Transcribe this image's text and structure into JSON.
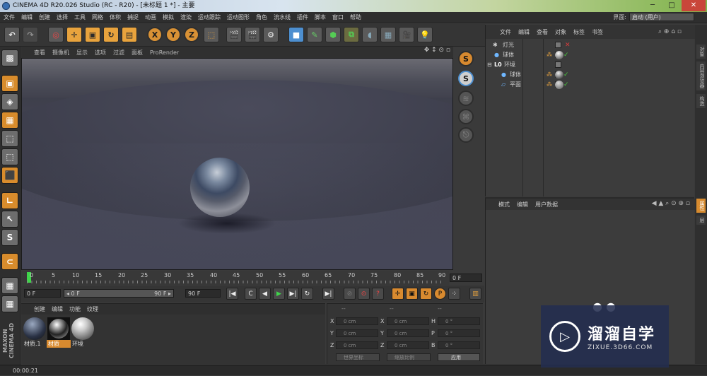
{
  "window": {
    "title": "CINEMA 4D R20.026 Studio (RC - R20) - [未标题 1 *] - 主要",
    "minimize": "─",
    "maximize": "□",
    "close": "✕"
  },
  "menu": [
    "文件",
    "编辑",
    "创建",
    "选择",
    "工具",
    "网格",
    "体积",
    "捕捉",
    "动画",
    "模拟",
    "渲染",
    "运动跟踪",
    "运动图形",
    "角色",
    "流水线",
    "插件",
    "脚本",
    "窗口",
    "帮助"
  ],
  "layout": {
    "label": "界面:",
    "value": "启动 (用户)"
  },
  "viewport": {
    "menu": [
      "查看",
      "摄像机",
      "显示",
      "选项",
      "过滤",
      "面板",
      "ProRender"
    ]
  },
  "objects": {
    "menu": [
      "文件",
      "编辑",
      "查看",
      "对象",
      "标签",
      "书签"
    ],
    "rows": [
      {
        "name": "灯光"
      },
      {
        "name": "球体"
      },
      {
        "name": "环境"
      },
      {
        "name": "球体"
      },
      {
        "name": "平面"
      }
    ]
  },
  "attributes": {
    "menu": [
      "模式",
      "编辑",
      "用户数据"
    ]
  },
  "side_tabs": [
    "对象",
    "内容浏览器",
    "构造",
    "属性",
    "层"
  ],
  "timeline": {
    "ticks": [
      "0",
      "5",
      "10",
      "15",
      "20",
      "25",
      "30",
      "35",
      "40",
      "45",
      "50",
      "55",
      "60",
      "65",
      "70",
      "75",
      "80",
      "85",
      "90"
    ],
    "frame_value": "0 F",
    "start_field": "0 F",
    "range_start": "◂ 0 F",
    "range_end": "90 F ▸",
    "end_field": "90 F"
  },
  "materials": {
    "menu": [
      "创建",
      "编辑",
      "功能",
      "纹理"
    ],
    "items": [
      {
        "label": "材质.1"
      },
      {
        "label": "材质"
      },
      {
        "label": "环境"
      }
    ]
  },
  "coordinates": {
    "headers": [
      "--",
      "--",
      "--"
    ],
    "rows": [
      {
        "a": "X",
        "av": "0 cm",
        "b": "X",
        "bv": "0 cm",
        "c": "H",
        "cv": "0 °"
      },
      {
        "a": "Y",
        "av": "0 cm",
        "b": "Y",
        "bv": "0 cm",
        "c": "P",
        "cv": "0 °"
      },
      {
        "a": "Z",
        "av": "0 cm",
        "b": "Z",
        "bv": "0 cm",
        "c": "B",
        "cv": "0 °"
      }
    ],
    "mode1": "世界坐标",
    "mode2": "缩放比例",
    "apply": "应用"
  },
  "status": {
    "time": "00:00:21"
  },
  "brand": "MAXON CINEMA 4D",
  "watermark": {
    "title": "溜溜自学",
    "url": "ZIXUE.3D66.COM"
  }
}
